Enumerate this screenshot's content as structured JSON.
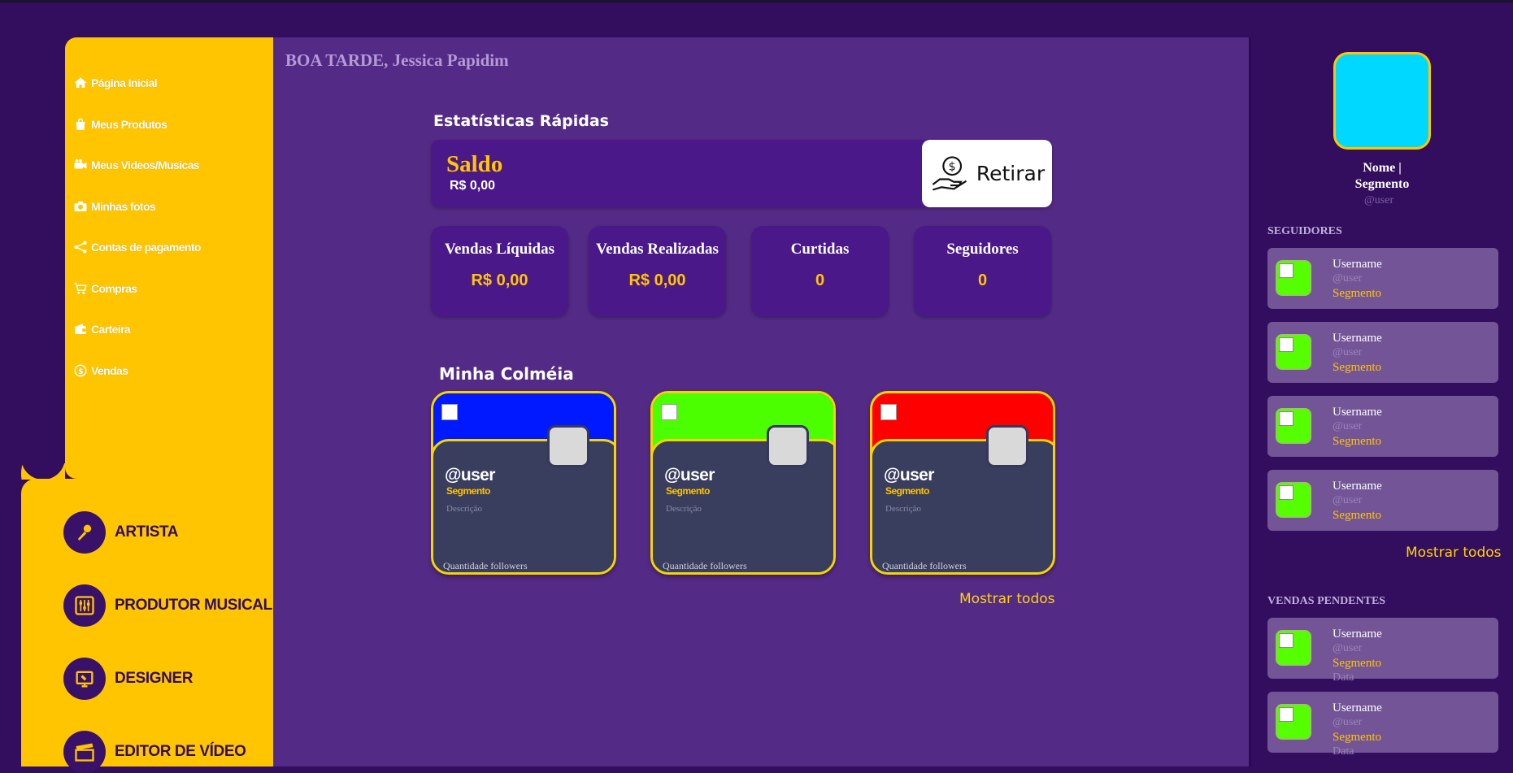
{
  "greeting": "BOA TARDE, Jessica Papidim",
  "nav": [
    {
      "label": "Página Inicial",
      "icon": "home-icon"
    },
    {
      "label": "Meus Produtos",
      "icon": "shopping-bag-icon"
    },
    {
      "label": "Meus Videos/Musicas",
      "icon": "video-camera-icon"
    },
    {
      "label": "Minhas fotos",
      "icon": "camera-icon"
    },
    {
      "label": "Contas de pagamento",
      "icon": "share-icon"
    },
    {
      "label": "Compras",
      "icon": "cart-icon"
    },
    {
      "label": "Carteira",
      "icon": "wallet-icon"
    },
    {
      "label": "Vendas",
      "icon": "dollar-circle-icon"
    }
  ],
  "categories": [
    {
      "label": "ARTISTA",
      "icon": "microphone-icon"
    },
    {
      "label": "PRODUTOR MUSICAL",
      "icon": "mixer-icon"
    },
    {
      "label": "DESIGNER",
      "icon": "design-tablet-icon"
    },
    {
      "label": "EDITOR DE VÍDEO",
      "icon": "clapperboard-icon"
    }
  ],
  "quick_stats": {
    "title": "Estatísticas Rápidas",
    "saldo_label": "Saldo",
    "saldo_value": "R$ 0,00",
    "withdraw_label": "Retirar",
    "stats": [
      {
        "label": "Vendas Líquidas",
        "value": "R$ 0,00"
      },
      {
        "label": "Vendas Realizadas",
        "value": "R$ 0,00"
      },
      {
        "label": "Curtidas",
        "value": "0"
      },
      {
        "label": "Seguidores",
        "value": "0"
      }
    ]
  },
  "hive": {
    "title": "Minha Colméia",
    "show_all": "Mostrar todos",
    "cards": [
      {
        "color": "#0019ff",
        "user": "@user",
        "segment": "Segmento",
        "description": "Descrição",
        "followers": "Quantidade followers"
      },
      {
        "color": "#4cff00",
        "user": "@user",
        "segment": "Segmento",
        "description": "Descrição",
        "followers": "Quantidade followers"
      },
      {
        "color": "#ff0000",
        "user": "@user",
        "segment": "Segmento",
        "description": "Descrição",
        "followers": "Quantidade followers"
      }
    ]
  },
  "profile": {
    "name_line1": "Nome |",
    "name_line2": "Segmento",
    "user": "@user"
  },
  "followers": {
    "title": "SEGUIDORES",
    "show_all": "Mostrar todos",
    "items": [
      {
        "name": "Username",
        "user": "@user",
        "segment": "Segmento"
      },
      {
        "name": "Username",
        "user": "@user",
        "segment": "Segmento"
      },
      {
        "name": "Username",
        "user": "@user",
        "segment": "Segmento"
      },
      {
        "name": "Username",
        "user": "@user",
        "segment": "Segmento"
      }
    ]
  },
  "pending_sales": {
    "title": "VENDAS PENDENTES",
    "items": [
      {
        "name": "Username",
        "user": "@user",
        "segment": "Segmento",
        "date": "Data"
      },
      {
        "name": "Username",
        "user": "@user",
        "segment": "Segmento",
        "date": "Data"
      }
    ]
  }
}
